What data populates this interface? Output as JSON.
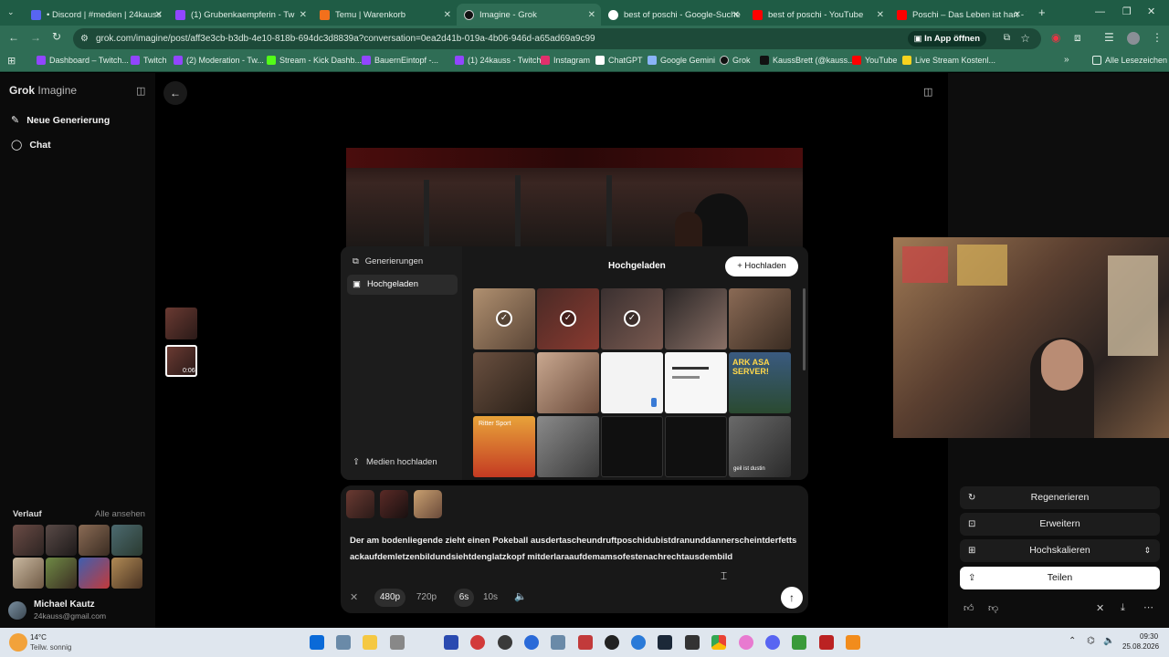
{
  "browser": {
    "tabs": [
      {
        "label": "• Discord | #medien | 24kauss",
        "color": "#5865f2"
      },
      {
        "label": "(1) Grubenkaempferin - Tw",
        "color": "#9146ff"
      },
      {
        "label": "Temu | Warenkorb",
        "color": "#f2701c"
      },
      {
        "label": "Imagine - Grok",
        "color": "#111111"
      },
      {
        "label": "best of poschi - Google-Suche",
        "color": "#ffffff"
      },
      {
        "label": "best of poschi - YouTube",
        "color": "#ff0000"
      },
      {
        "label": "Poschi – Das Leben ist hart - Yo",
        "color": "#ff0000"
      }
    ],
    "url": "grok.com/imagine/post/aff3e3cb-b3db-4e10-818b-694dc3d8839a?conversation=0ea2d41b-019a-4b06-946d-a65ad69a9c99",
    "open_in_app": "In App öffnen",
    "bookmarks": [
      {
        "label": "Dashboard – Twitch...",
        "color": "#9146ff"
      },
      {
        "label": "Twitch",
        "color": "#9146ff"
      },
      {
        "label": "(2) Moderation - Tw...",
        "color": "#9146ff"
      },
      {
        "label": "Stream - Kick Dashb...",
        "color": "#53fc18"
      },
      {
        "label": "BauernEintopf -...",
        "color": "#9146ff"
      },
      {
        "label": "(1) 24kauss - Twitch",
        "color": "#9146ff"
      },
      {
        "label": "Instagram",
        "color": "#e1306c"
      },
      {
        "label": "ChatGPT",
        "color": "#ffffff"
      },
      {
        "label": "Google Gemini",
        "color": "#8ab4f8"
      },
      {
        "label": "Grok",
        "color": "#111111"
      },
      {
        "label": "KaussBrett (@kauss...",
        "color": "#111111"
      },
      {
        "label": "YouTube",
        "color": "#ff0000"
      },
      {
        "label": "Live Stream Kostenl...",
        "color": "#f7d31e"
      }
    ],
    "all_bookmarks": "Alle Lesezeichen"
  },
  "sidebar": {
    "logo_bold": "Grok",
    "logo_light": "Imagine",
    "new_generation": "Neue Generierung",
    "chat": "Chat",
    "history_label": "Verlauf",
    "see_all": "Alle ansehen",
    "user_name": "Michael Kautz",
    "user_email": "24kauss@gmail.com"
  },
  "main": {
    "thumb_time": "0:06"
  },
  "popup": {
    "menu_generations": "Generierungen",
    "menu_uploaded": "Hochgeladen",
    "menu_upload_media": "Medien hochladen",
    "title": "Hochgeladen",
    "upload_button": "Hochladen",
    "tile_texts": [
      "ARK ASA SERVER!",
      "Ritter Sport",
      "geil ist dustin"
    ]
  },
  "prompt": {
    "text": "Der am bodenliegende zieht einen Pokeball ausdertascheundruftposchidubistdranunddannerscheintderfettsackaufdemletzenbildundsiehtdenglatzkopf mitderlaraaufdemamsofestenachrechtausdembild",
    "res_480": "480p",
    "res_720": "720p",
    "dur_6": "6s",
    "dur_10": "10s"
  },
  "actions": {
    "regenerate": "Regenerieren",
    "extend": "Erweitern",
    "upscale": "Hochskalieren",
    "share": "Teilen"
  },
  "taskbar": {
    "weather_temp": "14°C",
    "weather_desc": "Teilw. sonnig",
    "time": "09:30",
    "date": "25.08.2026"
  }
}
